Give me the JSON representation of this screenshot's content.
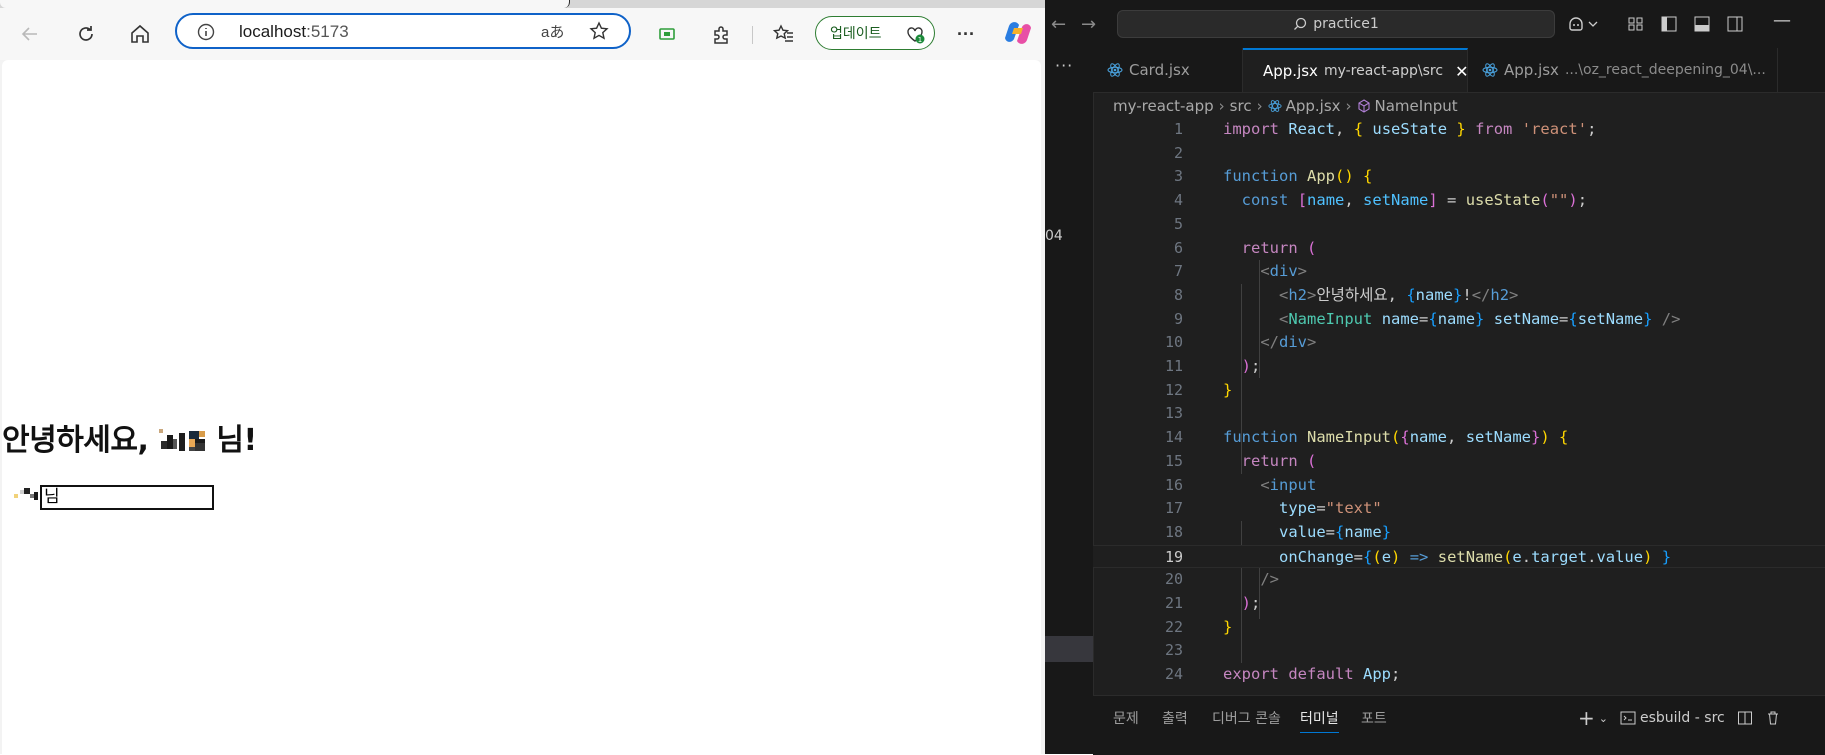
{
  "browser": {
    "nav": {
      "back_icon": "arrow-left-icon",
      "refresh_icon": "refresh-icon",
      "home_icon": "home-icon"
    },
    "address": {
      "host": "localhost",
      "port": ":5173",
      "read_aloud": "aあ"
    },
    "toolbar": {
      "update_label": "업데이트",
      "more_label": "···"
    },
    "page": {
      "greeting_prefix": "안녕하세요,",
      "greeting_suffix": "님!",
      "input_value": "님"
    }
  },
  "vscode": {
    "command_center": "practice1",
    "left_fragment": "04",
    "more_label": "···",
    "tabs": [
      {
        "label": "Card.jsx",
        "desc": ""
      },
      {
        "label": "App.jsx",
        "desc": "my-react-app\\src"
      },
      {
        "label": "App.jsx",
        "desc": "...\\oz_react_deepening_04\\..."
      }
    ],
    "breadcrumb": {
      "root": "my-react-app",
      "folder": "src",
      "file": "App.jsx",
      "symbol": "NameInput"
    },
    "line_numbers": [
      "1",
      "2",
      "3",
      "4",
      "5",
      "6",
      "7",
      "8",
      "9",
      "10",
      "11",
      "12",
      "13",
      "14",
      "15",
      "16",
      "17",
      "18",
      "19",
      "20",
      "21",
      "22",
      "23",
      "24"
    ],
    "current_line": 19,
    "panel": {
      "tabs": [
        "문제",
        "출력",
        "디버그 콘솔",
        "터미널",
        "포트"
      ],
      "active_tab": "터미널",
      "terminal_name": "esbuild - src",
      "add_label": "+"
    }
  },
  "colors": {
    "address_focus": "#0f62c8",
    "update_green": "#2e7d32",
    "vscode_bg": "#1f1f1f",
    "accent_blue": "#0078d4"
  }
}
